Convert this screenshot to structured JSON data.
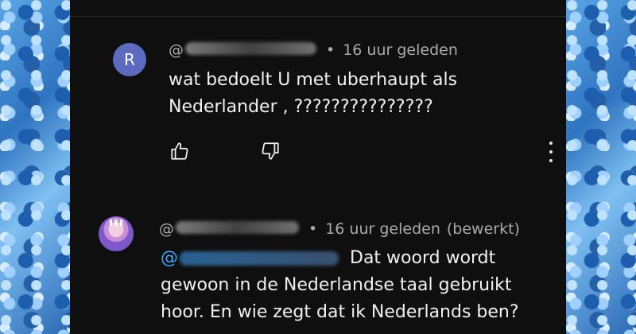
{
  "comments": [
    {
      "avatar_letter": "R",
      "handle_prefix": "@",
      "handle_blurred": "robertneven7563",
      "time": "16 uur geleden",
      "edited": "",
      "line1": "wat bedoelt U met uberhaupt als",
      "line2": "Nederlander , ???????????????",
      "avatar_color": "#5c6bc0"
    },
    {
      "handle_prefix": "@",
      "handle_blurred": "nickysmits2587",
      "time": "16 uur geleden",
      "edited": "(bewerkt)",
      "mention_prefix": "@",
      "mention_blurred": "robertneven7563",
      "line1_rest": "Dat woord wordt",
      "line2": "gewoon in de Nederlandse taal gebruikt",
      "line3": "hoor. En wie zegt dat ik Nederlands ben?"
    }
  ],
  "separator": "•",
  "icons": [
    "thumbs-up-icon",
    "thumbs-down-icon",
    "more-vert-icon"
  ],
  "colors": {
    "background": "#0f0f0f",
    "text": "#f1f1f1",
    "meta": "#aaaaaa",
    "mention": "#3ea6ff"
  }
}
